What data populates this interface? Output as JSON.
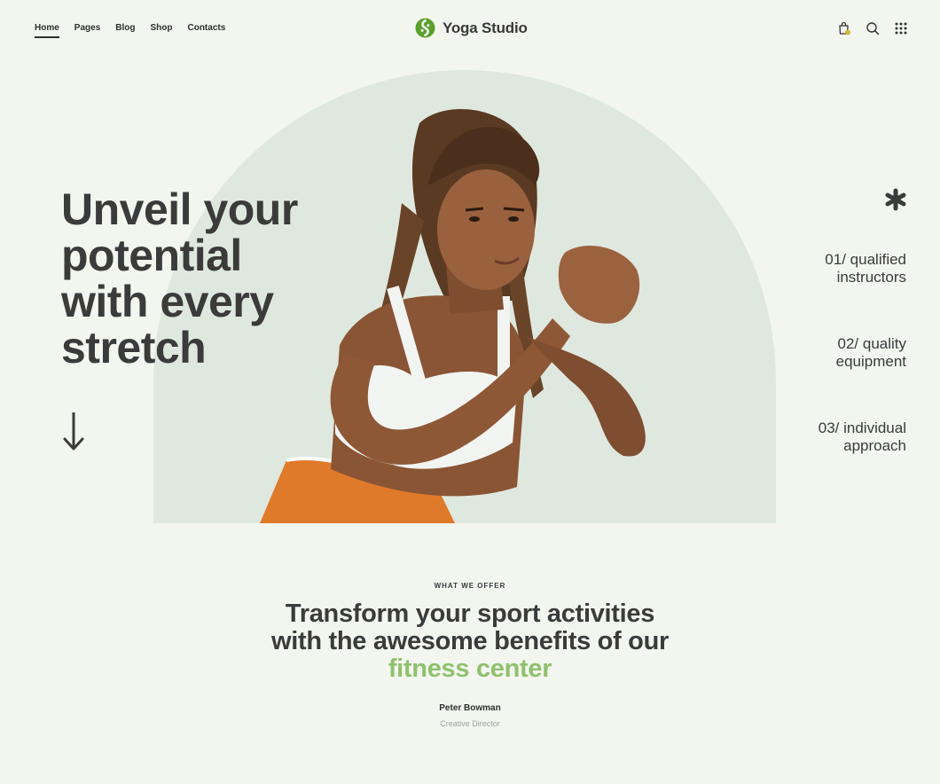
{
  "nav": {
    "items": [
      {
        "label": "Home",
        "active": true
      },
      {
        "label": "Pages",
        "active": false
      },
      {
        "label": "Blog",
        "active": false
      },
      {
        "label": "Shop",
        "active": false
      },
      {
        "label": "Contacts",
        "active": false
      }
    ]
  },
  "brand": {
    "name": "Yoga Studio",
    "logo_icon": "yin-yang-leaf-icon",
    "accent_color": "#5aa02c"
  },
  "header_icons": [
    "cart-icon",
    "search-icon",
    "grid-menu-icon"
  ],
  "hero": {
    "title": "Unveil your potential with every stretch",
    "features": [
      {
        "num": "01/",
        "text": "qualified instructors"
      },
      {
        "num": "02/",
        "text": "quality equipment"
      },
      {
        "num": "03/",
        "text": "individual approach"
      }
    ],
    "arch_color": "#dfe8df"
  },
  "offer": {
    "label": "WHAT WE OFFER",
    "title_line1": "Transform your sport activities",
    "title_line2": "with the awesome benefits of our",
    "title_highlight": "fitness center",
    "highlight_color": "#8fc16e",
    "author_name": "Peter Bowman",
    "author_role": "Creative Director"
  }
}
